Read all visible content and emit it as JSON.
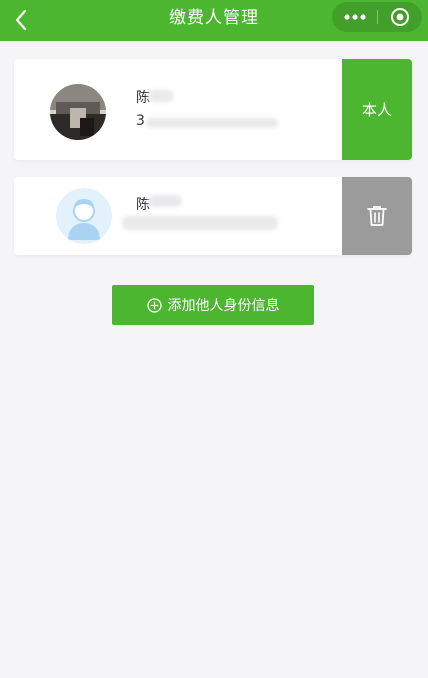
{
  "nav": {
    "title": "缴费人管理",
    "back_icon": "chevron-left-icon",
    "more_icon": "more-dots-icon",
    "close_icon": "target-circle-icon"
  },
  "payers": [
    {
      "name_visible": "陈",
      "phone_visible": "3",
      "action_label": "本人",
      "avatar": "photo-avatar"
    },
    {
      "name_visible": "陈",
      "action_icon": "trash-icon",
      "avatar": "default-user-avatar"
    }
  ],
  "add_button": {
    "label": "添加他人身份信息",
    "icon": "plus-circle-icon"
  },
  "colors": {
    "brand_green": "#4cb630",
    "delete_gray": "#9b9b9b",
    "page_bg": "#f5f5f7"
  }
}
